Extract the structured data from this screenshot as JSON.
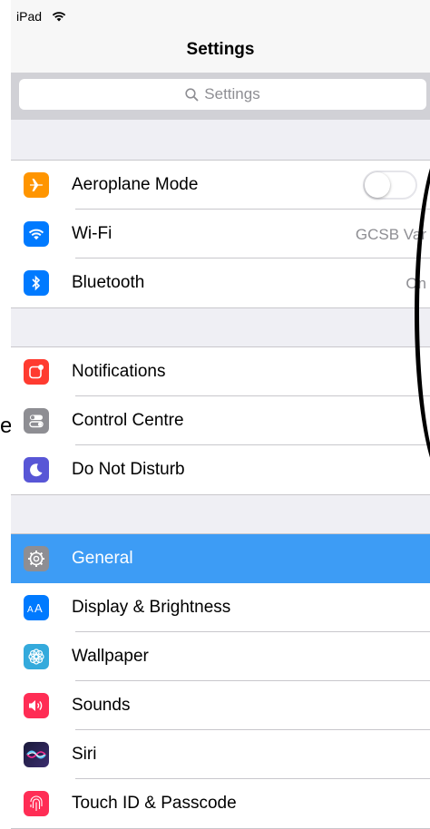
{
  "status": {
    "device": "iPad"
  },
  "header": {
    "title": "Settings"
  },
  "search": {
    "placeholder": "Settings"
  },
  "outer_text": "e",
  "groups": [
    {
      "rows": [
        {
          "label": "Aeroplane Mode",
          "icon": "airplane-icon",
          "color": "#ff9500"
        },
        {
          "label": "Wi-Fi",
          "value": "GCSB Var",
          "icon": "wifi-icon",
          "color": "#007aff"
        },
        {
          "label": "Bluetooth",
          "value": "On",
          "icon": "bluetooth-icon",
          "color": "#007aff"
        }
      ]
    },
    {
      "rows": [
        {
          "label": "Notifications",
          "icon": "notifications-icon",
          "color": "#ff3b30"
        },
        {
          "label": "Control Centre",
          "icon": "control-centre-icon",
          "color": "#8e8e93"
        },
        {
          "label": "Do Not Disturb",
          "icon": "moon-icon",
          "color": "#5856d6"
        }
      ]
    },
    {
      "rows": [
        {
          "label": "General",
          "icon": "gear-icon",
          "color": "#8e8e93",
          "selected": true
        },
        {
          "label": "Display & Brightness",
          "icon": "display-icon",
          "color": "#007aff"
        },
        {
          "label": "Wallpaper",
          "icon": "wallpaper-icon",
          "color": "#34aadc"
        },
        {
          "label": "Sounds",
          "icon": "sounds-icon",
          "color": "#ff2d55"
        },
        {
          "label": "Siri",
          "icon": "siri-icon",
          "color": "#1c1c3c"
        },
        {
          "label": "Touch ID & Passcode",
          "icon": "fingerprint-icon",
          "color": "#ff2d55"
        }
      ]
    }
  ],
  "aeroplane_toggle": {
    "on": false
  }
}
